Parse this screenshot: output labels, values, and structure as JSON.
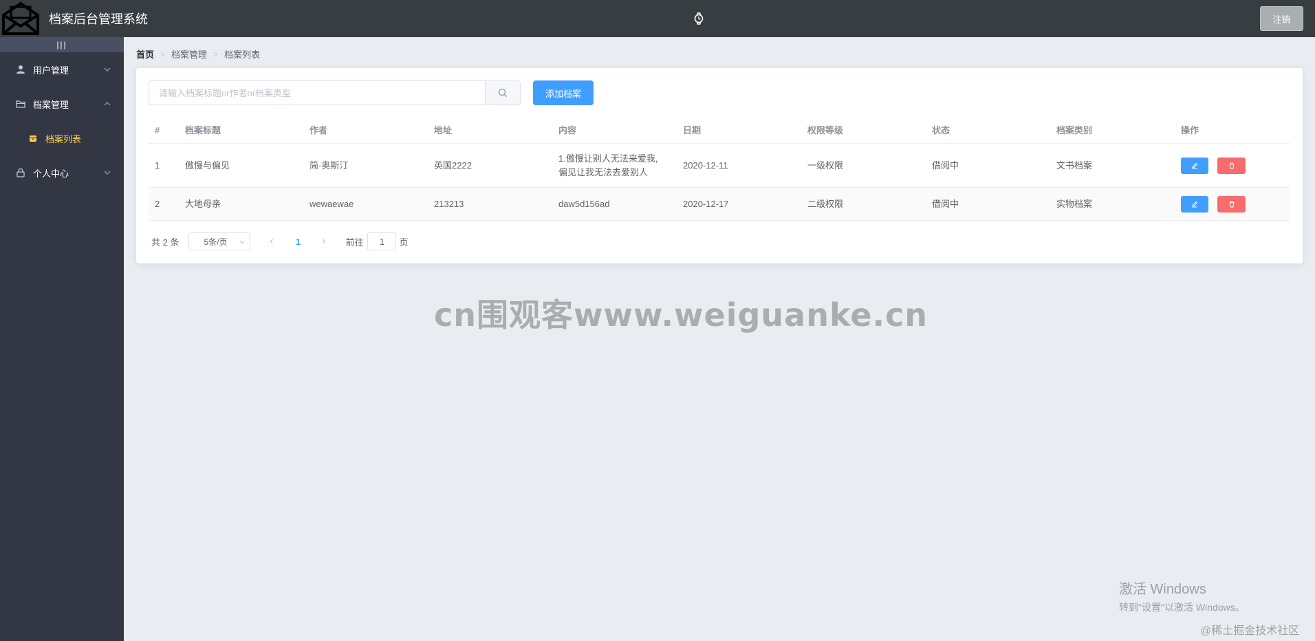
{
  "header": {
    "title": "档案后台管理系统",
    "logout_label": "注销"
  },
  "sidebar": {
    "toggle_label": "|||",
    "menus": [
      {
        "label": "用户管理",
        "icon": "user-icon",
        "expanded": false
      },
      {
        "label": "档案管理",
        "icon": "folder-icon",
        "expanded": true,
        "children": [
          {
            "label": "档案列表",
            "icon": "archive-icon",
            "active": true
          }
        ]
      },
      {
        "label": "个人中心",
        "icon": "lock-icon",
        "expanded": false
      }
    ]
  },
  "breadcrumb": [
    "首页",
    "档案管理",
    "档案列表"
  ],
  "toolbar": {
    "search_placeholder": "请输入档案标题or作者or档案类型",
    "search_value": "",
    "add_label": "添加档案"
  },
  "table": {
    "headers": [
      "#",
      "档案标题",
      "作者",
      "地址",
      "内容",
      "日期",
      "权限等级",
      "状态",
      "档案类别",
      "操作"
    ],
    "rows": [
      {
        "index": "1",
        "title": "傲慢与偏见",
        "author": "简·奥斯汀",
        "address": "英国2222",
        "content": "1.傲慢让别人无法来爱我,偏见让我无法去爱别人",
        "date": "2020-12-11",
        "level": "一级权限",
        "status": "借阅中",
        "category": "文书档案"
      },
      {
        "index": "2",
        "title": "大地母亲",
        "author": "wewaewae",
        "address": "213213",
        "content": "daw5d156ad",
        "date": "2020-12-17",
        "level": "二级权限",
        "status": "借阅中",
        "category": "实物档案"
      }
    ]
  },
  "pagination": {
    "total_text": "共 2 条",
    "page_size": "5条/页",
    "current_page": "1",
    "goto_prefix": "前往",
    "goto_value": "1",
    "goto_suffix": "页"
  },
  "watermarks": {
    "center": "cn围观客www.weiguanke.cn",
    "windows_line1": "激活 Windows",
    "windows_line2": "转到\"设置\"以激活 Windows。",
    "community": "@稀土掘金技术社区"
  },
  "colors": {
    "header_bg": "#373d41",
    "sidebar_bg": "#333744",
    "active_menu": "#ffd04b",
    "primary": "#409eff",
    "danger": "#f56c6c"
  }
}
